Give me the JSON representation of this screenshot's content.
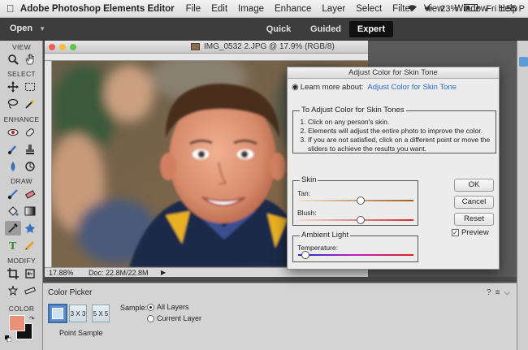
{
  "menubar": {
    "app_name": "Adobe Photoshop Elements Editor",
    "items": [
      "File",
      "Edit",
      "Image",
      "Enhance",
      "Layer",
      "Select",
      "Filter",
      "View",
      "Window",
      "Help"
    ],
    "battery": "23%",
    "clock": "Fri 1:55 P"
  },
  "appbar": {
    "open_label": "Open",
    "modes": {
      "quick": "Quick",
      "guided": "Guided",
      "expert": "Expert"
    },
    "active_mode": "Expert"
  },
  "toolbar": {
    "sections": {
      "view": "VIEW",
      "select": "SELECT",
      "enhance": "ENHANCE",
      "draw": "DRAW",
      "modify": "MODIFY",
      "color": "COLOR"
    },
    "foreground_color": "#e8927a",
    "background_color": "#111111"
  },
  "document": {
    "title": "IMG_0532 2.JPG @ 17.9% (RGB/8)",
    "zoom": "17.88%",
    "doc_size": "Doc: 22.8M/22.8M"
  },
  "dialog": {
    "title": "Adjust Color for Skin Tone",
    "learn_prefix": "Learn more about:",
    "learn_link": "Adjust Color for Skin Tone",
    "instructions_title": "To Adjust Color for Skin Tones",
    "instructions": [
      "Click on any person's skin.",
      "Elements will adjust the entire photo to improve the color.",
      "If you are not satisfied, click on a different point or move the sliders to achieve the results you want."
    ],
    "skin_title": "Skin",
    "tan_label": "Tan:",
    "tan_level": 0.54,
    "blush_label": "Blush:",
    "blush_level": 0.54,
    "ambient_title": "Ambient Light",
    "temperature_label": "Temperature:",
    "temperature_level": 0.06,
    "ok": "OK",
    "cancel": "Cancel",
    "reset": "Reset",
    "preview": "Preview",
    "preview_checked": true
  },
  "options": {
    "title": "Color Picker",
    "sample_3": "3 X 3",
    "sample_5": "5 X 5",
    "point_sample": "Point Sample",
    "sample_label": "Sample:",
    "all_layers": "All Layers",
    "current_layer": "Current Layer",
    "selected_sample": "All Layers"
  }
}
